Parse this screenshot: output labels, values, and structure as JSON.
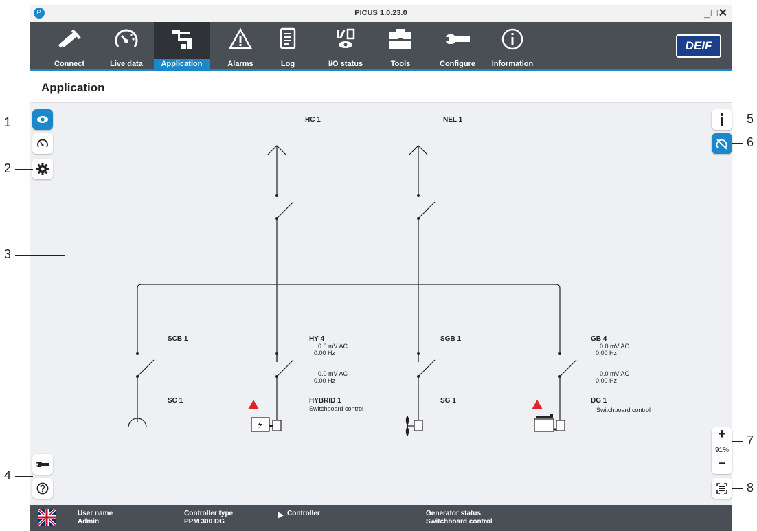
{
  "window": {
    "title": "PICUS 1.0.23.0",
    "logo_letter": "P",
    "controls": "_□✕"
  },
  "nav": {
    "items": [
      {
        "label": "Connect",
        "icon": "plug-icon"
      },
      {
        "label": "Live data",
        "icon": "gauge-icon"
      },
      {
        "label": "Application",
        "icon": "application-icon",
        "active": true
      },
      {
        "label": "Alarms",
        "icon": "warning-icon"
      },
      {
        "label": "Log",
        "icon": "log-icon"
      },
      {
        "label": "I/O status",
        "icon": "io-status-icon"
      },
      {
        "label": "Tools",
        "icon": "toolbox-icon"
      },
      {
        "label": "Configure",
        "icon": "wrench-icon"
      },
      {
        "label": "Information",
        "icon": "info-icon"
      }
    ],
    "brand": "DEIF"
  },
  "page": {
    "title": "Application"
  },
  "diagram": {
    "loads": [
      {
        "label": "HC 1"
      },
      {
        "label": "NEL 1"
      }
    ],
    "breakers": [
      {
        "label": "SCB 1"
      },
      {
        "label": "HY 4",
        "line1": "0.0 mV AC",
        "line2": "0.00 Hz",
        "line3": "0.0 mV AC",
        "line4": "0.00 Hz"
      },
      {
        "label": "SGB 1"
      },
      {
        "label": "GB 4",
        "line1": "0.0 mV AC",
        "line2": "0.00 Hz",
        "line3": "0.0 mV AC",
        "line4": "0.00 Hz"
      }
    ],
    "sources": [
      {
        "label": "SC 1",
        "status": ""
      },
      {
        "label": "HYBRID 1",
        "status": "Switchboard control"
      },
      {
        "label": "SG 1",
        "status": ""
      },
      {
        "label": "DG 1",
        "status": "Switchboard control"
      }
    ]
  },
  "zoom": {
    "plus": "+",
    "level": "91%",
    "minus": "−"
  },
  "status_bar": {
    "user_name_label": "User name",
    "user_name_value": "Admin",
    "controller_type_label": "Controller type",
    "controller_type_value": "PPM 300 DG",
    "controller_label": "Controller",
    "generator_status_label": "Generator status",
    "generator_status_value": "Switchboard control"
  },
  "callouts": [
    "1",
    "2",
    "3",
    "4",
    "5",
    "6",
    "7",
    "8"
  ],
  "colors": {
    "accent": "#1b88c9",
    "nav_bg": "#4a4f56",
    "alarm": "#e0242b",
    "canvas_bg": "#eef0f3"
  }
}
